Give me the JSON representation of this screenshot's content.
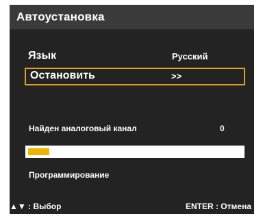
{
  "title": "Автоустановка",
  "menu": {
    "language": {
      "label": "Язык",
      "value": "Русский"
    },
    "stop": {
      "label": "Остановить",
      "value": ">>"
    }
  },
  "status": {
    "found_label": "Найден аналоговый канал",
    "found_count": "0"
  },
  "progress": {
    "fraction": 0.1
  },
  "programming_label": "Программирование",
  "footer": {
    "nav_arrows": "▲▼",
    "nav_label": ": Выбор",
    "enter_label": "ENTER : Отмена"
  },
  "colors": {
    "accent": "#e0a020",
    "progress_fill": "#f0b400",
    "panel": "#232323",
    "title_bar": "#3a3a3a"
  }
}
